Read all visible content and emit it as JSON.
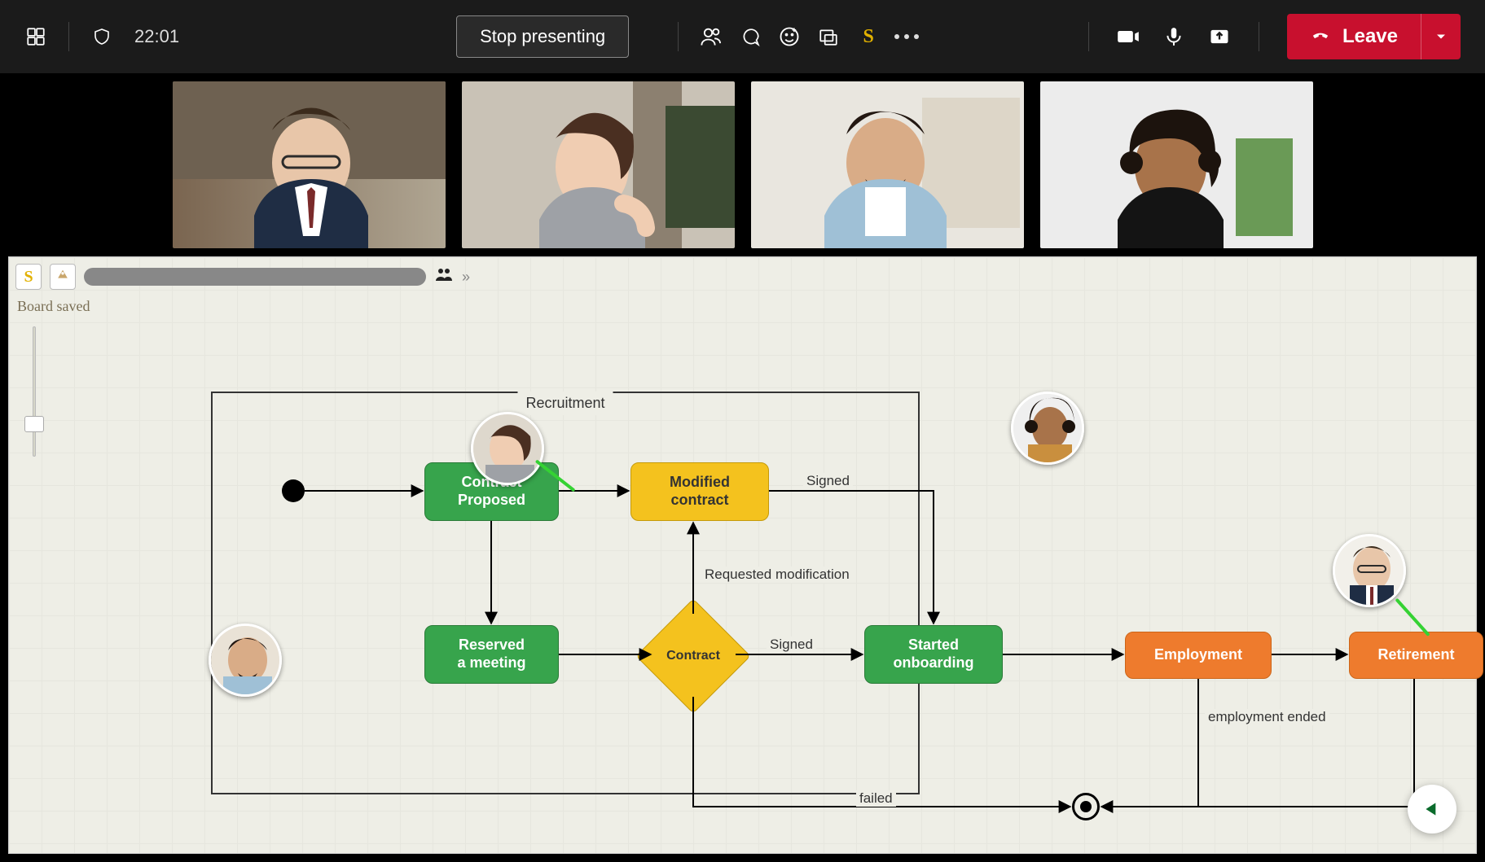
{
  "topbar": {
    "time": "22:01",
    "stop_presenting": "Stop presenting",
    "leave": "Leave"
  },
  "board": {
    "saved_label": "Board saved"
  },
  "diagram": {
    "frame_title": "Recruitment",
    "nodes": {
      "contract_proposed": "Contract\nProposed",
      "modified_contract": "Modified\ncontract",
      "reserved_meeting": "Reserved\na meeting",
      "contract": "Contract",
      "started_onboarding": "Started\nonboarding",
      "employment": "Employment",
      "retirement": "Retirement"
    },
    "edges": {
      "signed_top": "Signed",
      "requested_modification": "Requested modification",
      "signed_mid": "Signed",
      "employment_ended": "employment ended",
      "failed": "failed"
    }
  }
}
